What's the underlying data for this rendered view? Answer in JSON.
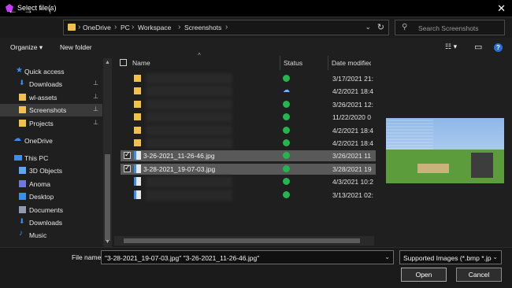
{
  "window": {
    "title": "Select file(s)",
    "close": "✕"
  },
  "nav": {
    "back": "←",
    "forward": "→",
    "dropdown": "⌄",
    "up": "↑"
  },
  "address": {
    "crumbs": [
      "OneDrive",
      "PC",
      "Workspace",
      "Screenshots"
    ],
    "separator": "›",
    "chevron": "⌄",
    "refresh": "↻"
  },
  "search": {
    "icon": "⚲",
    "placeholder": "Search Screenshots"
  },
  "toolbar": {
    "organize": "Organize ▾",
    "new_folder": "New folder",
    "view": "☷ ▾",
    "preview_pane": "▭",
    "help": "?"
  },
  "sidebar": {
    "items": [
      {
        "label": "Quick access",
        "icon": "star-icon",
        "pinned": false
      },
      {
        "label": "Downloads",
        "icon": "download-icon",
        "pinned": true
      },
      {
        "label": "wl-assets",
        "icon": "folder-icon",
        "pinned": true
      },
      {
        "label": "Screenshots",
        "icon": "folder-icon",
        "pinned": true,
        "selected": true
      },
      {
        "label": "Projects",
        "icon": "folder-icon",
        "pinned": true
      },
      {
        "label": "OneDrive",
        "icon": "cloud-icon",
        "pinned": false
      },
      {
        "label": "This PC",
        "icon": "pc-icon",
        "pinned": false
      },
      {
        "label": "3D Objects",
        "icon": "cube-icon",
        "pinned": false
      },
      {
        "label": "Anoma",
        "icon": "folder-icon",
        "pinned": false
      },
      {
        "label": "Desktop",
        "icon": "desktop-icon",
        "pinned": false
      },
      {
        "label": "Documents",
        "icon": "document-icon",
        "pinned": false
      },
      {
        "label": "Downloads",
        "icon": "download-icon",
        "pinned": false
      },
      {
        "label": "Music",
        "icon": "music-icon",
        "pinned": false
      }
    ],
    "pin_glyph": "📌"
  },
  "filelist": {
    "headers": {
      "name": "Name",
      "status": "Status",
      "date": "Date modified"
    },
    "sort_arrow": "^",
    "rows": [
      {
        "type": "folder",
        "name": "",
        "status": "ok",
        "date": "3/17/2021 21:",
        "checked": false,
        "selected": false
      },
      {
        "type": "folder",
        "name": "",
        "status": "cloud",
        "date": "4/2/2021 18:4",
        "checked": false,
        "selected": false
      },
      {
        "type": "folder",
        "name": "",
        "status": "ok",
        "date": "3/26/2021 12:",
        "checked": false,
        "selected": false
      },
      {
        "type": "folder",
        "name": "",
        "status": "ok",
        "date": "11/22/2020 0",
        "checked": false,
        "selected": false
      },
      {
        "type": "folder",
        "name": "",
        "status": "ok",
        "date": "4/2/2021 18:4",
        "checked": false,
        "selected": false
      },
      {
        "type": "folder",
        "name": "",
        "status": "ok",
        "date": "4/2/2021 18:4",
        "checked": false,
        "selected": false
      },
      {
        "type": "file",
        "name": "3-26-2021_11-26-46.jpg",
        "status": "ok",
        "date": "3/26/2021 11",
        "checked": true,
        "selected": true
      },
      {
        "type": "file",
        "name": "3-28-2021_19-07-03.jpg",
        "status": "ok",
        "date": "3/28/2021 19",
        "checked": true,
        "selected": true
      },
      {
        "type": "file",
        "name": "",
        "status": "ok",
        "date": "4/3/2021 10:2",
        "checked": false,
        "selected": false
      },
      {
        "type": "file",
        "name": "",
        "status": "ok",
        "date": "3/13/2021 02:",
        "checked": false,
        "selected": false
      }
    ]
  },
  "footer": {
    "file_name_label": "File name:",
    "file_name_value": "\"3-28-2021_19-07-03.jpg\" \"3-26-2021_11-26-46.jpg\"",
    "file_type_value": "Supported Images (*.bmp *.jpg",
    "dropdown": "⌄",
    "open": "Open",
    "cancel": "Cancel"
  }
}
